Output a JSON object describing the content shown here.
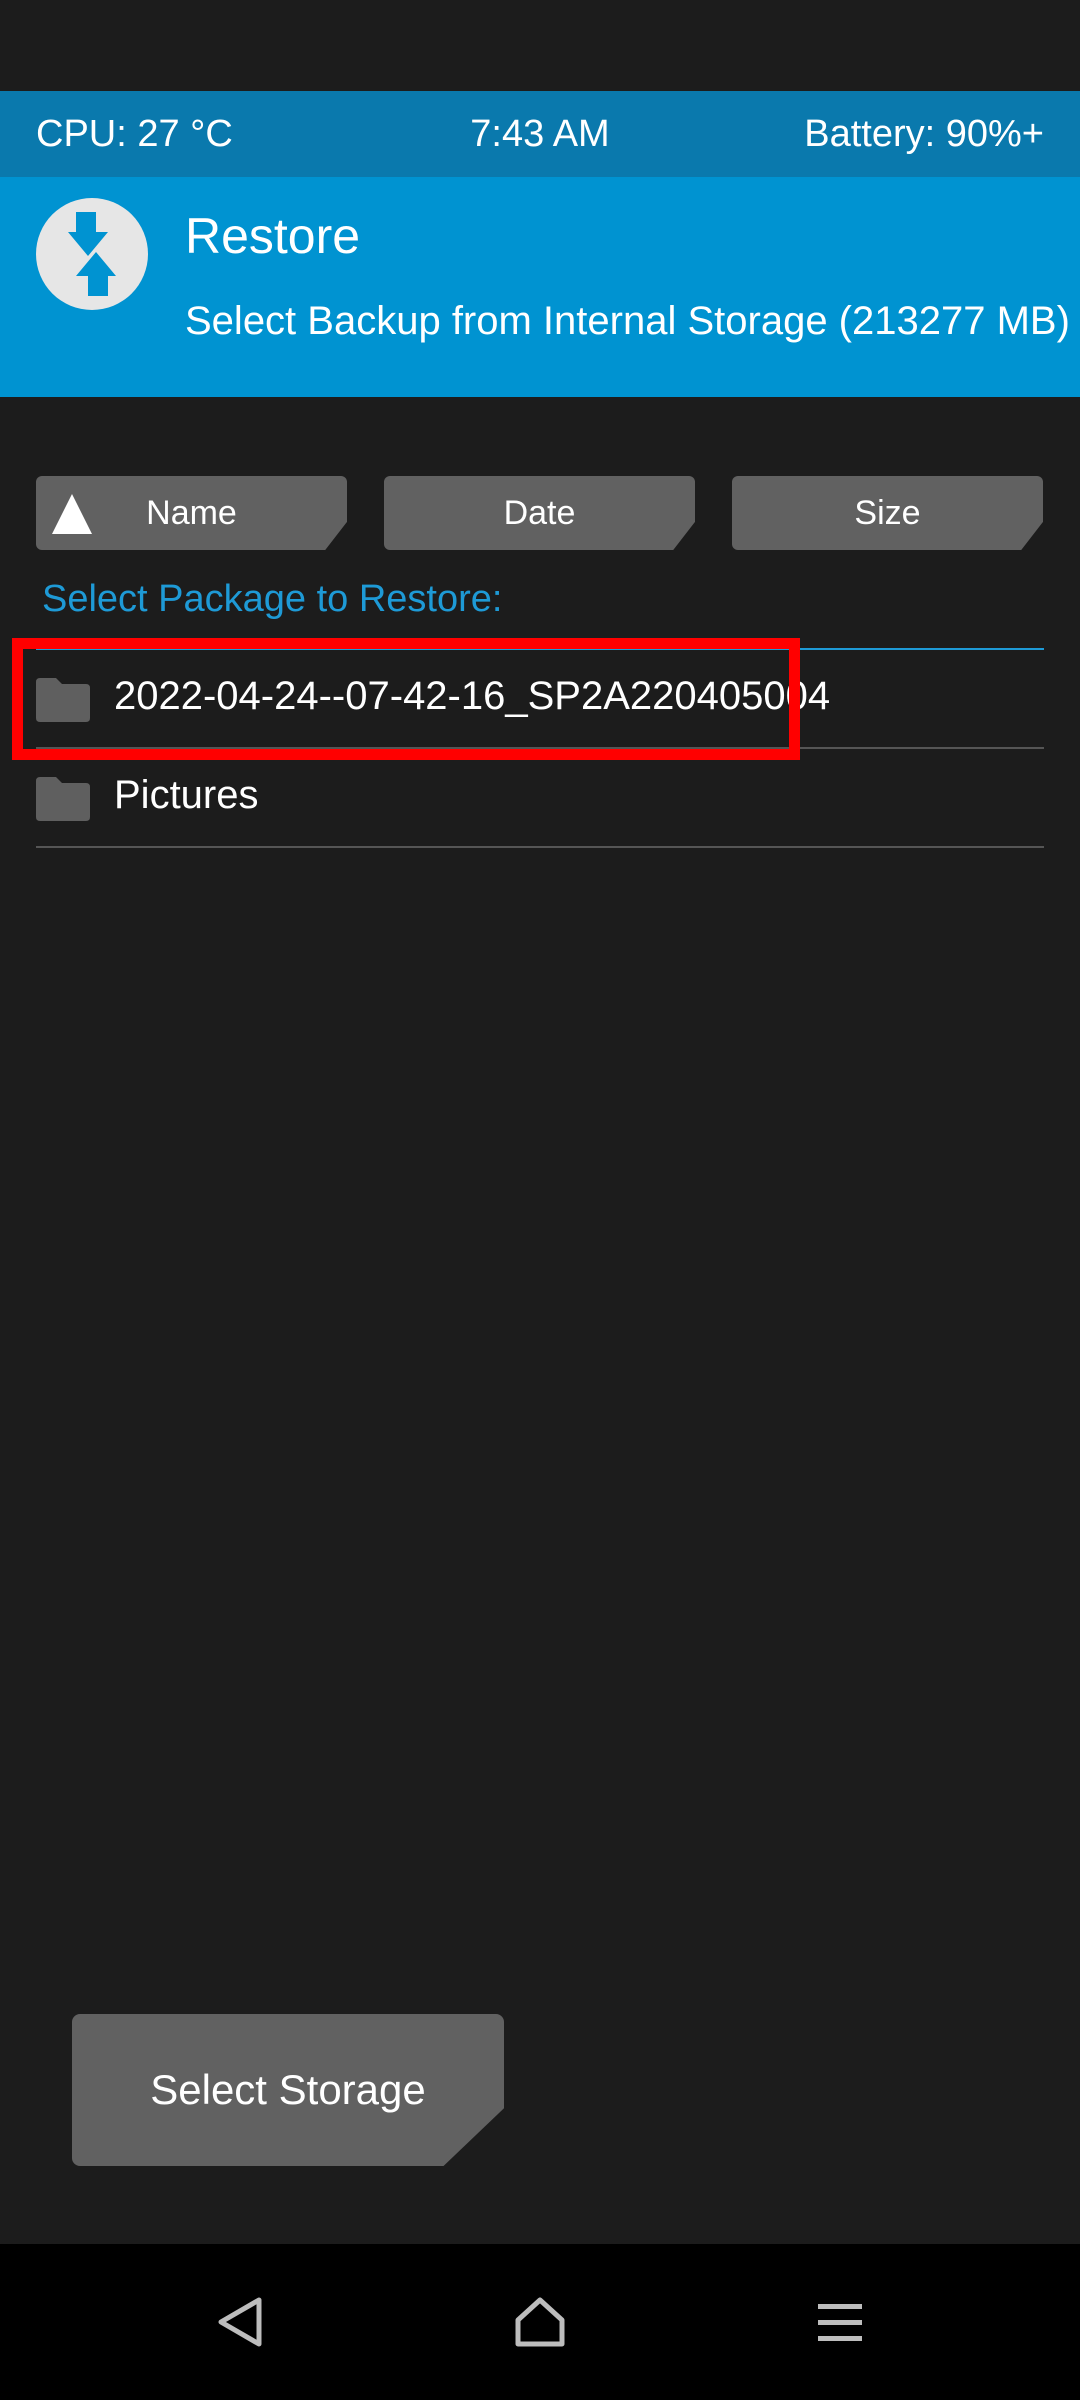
{
  "status": {
    "cpu": "CPU: 27 °C",
    "time": "7:43 AM",
    "battery": "Battery: 90%+"
  },
  "header": {
    "title": "Restore",
    "subtitle": "Select Backup from Internal Storage (213277 MB)",
    "logo_icon": "twrp-logo-icon"
  },
  "sort": {
    "name_label": "Name",
    "date_label": "Date",
    "size_label": "Size"
  },
  "section": {
    "label": "Select Package to Restore:"
  },
  "files": [
    {
      "name": "2022-04-24--07-42-16_SP2A220405004",
      "icon": "folder-icon"
    },
    {
      "name": "Pictures",
      "icon": "folder-icon"
    }
  ],
  "actions": {
    "select_storage": "Select Storage"
  },
  "colors": {
    "statusbar": "#0a79ad",
    "header": "#0093d1",
    "accent": "#1e9ad6",
    "button": "#616161",
    "highlight": "#ff0000"
  }
}
